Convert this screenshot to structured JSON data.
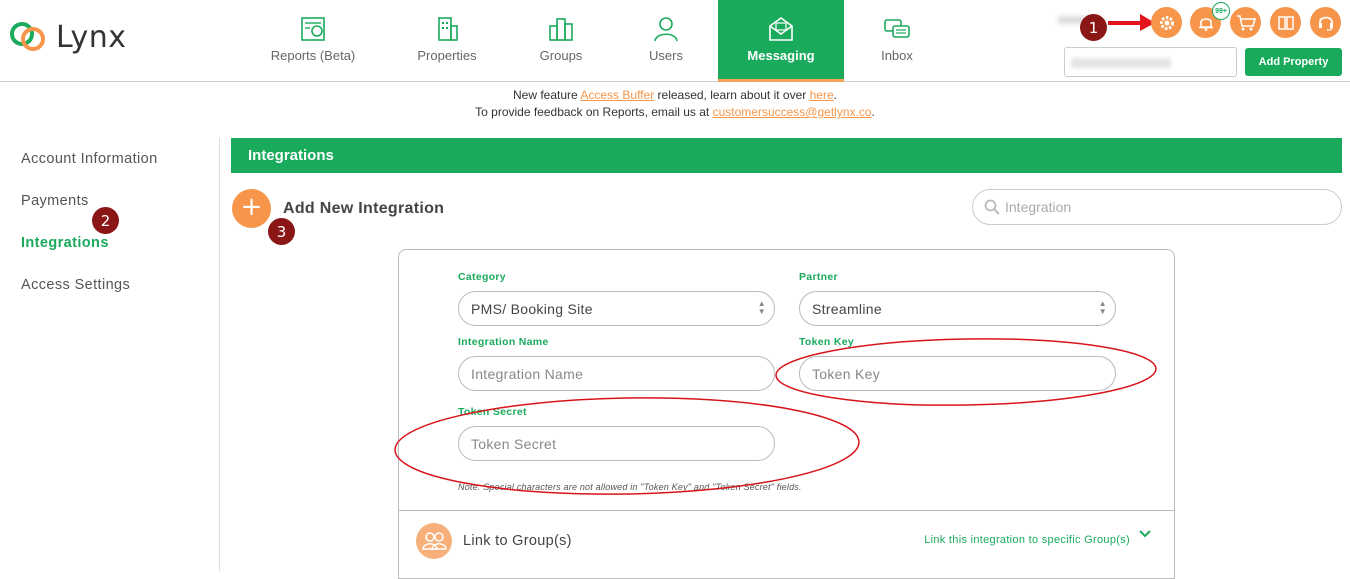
{
  "brand": {
    "name": "Lynx",
    "color": "#1aaa5c",
    "accent": "#f7964a"
  },
  "nav": {
    "items": [
      {
        "label": "Reports (Beta)",
        "icon": "reports-icon"
      },
      {
        "label": "Properties",
        "icon": "building-icon"
      },
      {
        "label": "Groups",
        "icon": "buildings-group-icon"
      },
      {
        "label": "Users",
        "icon": "user-icon"
      },
      {
        "label": "Messaging",
        "icon": "message-envelope-icon",
        "active": true
      },
      {
        "label": "Inbox",
        "icon": "chat-bubbles-icon"
      }
    ]
  },
  "header_actions": {
    "icons": [
      "gear-icon",
      "bell-icon",
      "cart-icon",
      "book-icon",
      "headset-icon"
    ],
    "notification_count": "99+",
    "add_property_label": "Add Property"
  },
  "markers": {
    "one": "1",
    "two": "2",
    "three": "3"
  },
  "announcement": {
    "line1_prefix": "New feature ",
    "line1_link": "Access Buffer",
    "line1_middle": " released, learn about it over ",
    "line1_link2": "here",
    "line1_suffix": ".",
    "line2_prefix": "To provide feedback on Reports, email us at ",
    "line2_email": "customersuccess@getlynx.co",
    "line2_suffix": "."
  },
  "sidebar": {
    "items": [
      {
        "label": "Account Information"
      },
      {
        "label": "Payments"
      },
      {
        "label": "Integrations",
        "active": true
      },
      {
        "label": "Access Settings"
      }
    ]
  },
  "main": {
    "section_title": "Integrations",
    "add_label": "Add New Integration",
    "search_placeholder": "Integration"
  },
  "form": {
    "category_label": "Category",
    "category_value": "PMS/ Booking Site",
    "partner_label": "Partner",
    "partner_value": "Streamline",
    "name_label": "Integration Name",
    "name_placeholder": "Integration Name",
    "token_key_label": "Token Key",
    "token_key_placeholder": "Token Key",
    "token_secret_label": "Token Secret",
    "token_secret_placeholder": "Token Secret",
    "note": "Note: Special characters are not allowed in \"Token Key\" and \"Token Secret\" fields."
  },
  "link_group": {
    "label": "Link to Group(s)",
    "description": "Link this integration to specific Group(s)"
  }
}
